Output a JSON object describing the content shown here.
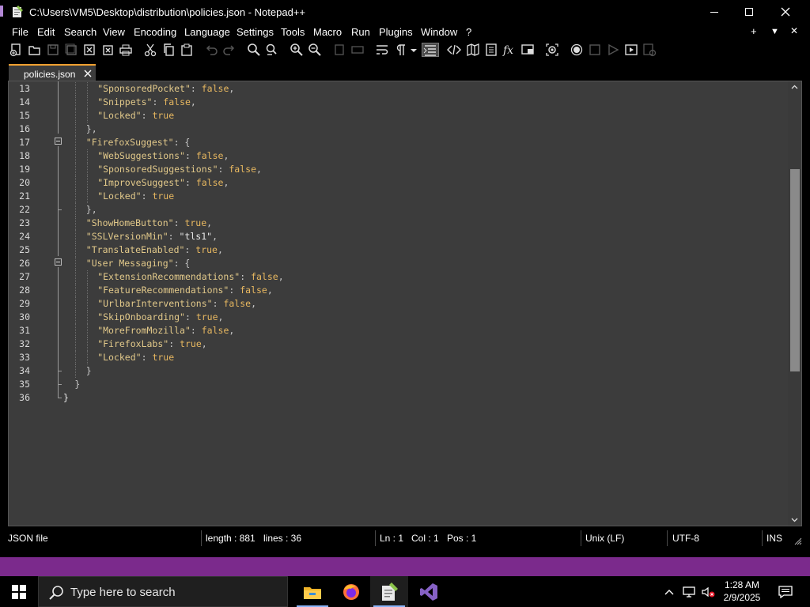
{
  "window": {
    "title": "C:\\Users\\VM5\\Desktop\\distribution\\policies.json - Notepad++"
  },
  "menu": {
    "items": [
      "File",
      "Edit",
      "Search",
      "View",
      "Encoding",
      "Language",
      "Settings",
      "Tools",
      "Macro",
      "Run",
      "Plugins",
      "Window",
      "?"
    ],
    "right": [
      "+",
      "▼",
      "✕"
    ]
  },
  "toolbar": {
    "icons": [
      "new-file-icon",
      "open-file-icon",
      "save-icon",
      "save-all-icon",
      "close-icon",
      "close-all-icon",
      "print-icon",
      "cut-icon",
      "copy-icon",
      "paste-icon",
      "undo-icon",
      "redo-icon",
      "find-icon",
      "replace-icon",
      "zoom-in-icon",
      "zoom-out-icon",
      "sync-vertical-icon",
      "sync-horizontal-icon",
      "word-wrap-icon",
      "show-all-characters-icon",
      "indent-guide-icon",
      "xml-tag-icon",
      "document-map-icon",
      "function-list-icon",
      "fx-icon",
      "folder-workspace-icon",
      "monitoring-icon",
      "record-macro-icon",
      "stop-record-icon",
      "play-macro-icon",
      "run-macro-multiple-icon",
      "save-macro-icon"
    ]
  },
  "tab": {
    "label": "policies.json"
  },
  "editor": {
    "lines": [
      {
        "n": "13",
        "indent": 3,
        "tokens": [
          [
            "s",
            "\"SponsoredPocket\""
          ],
          [
            "p",
            ": "
          ],
          [
            "b",
            "false"
          ],
          [
            "p",
            ","
          ]
        ]
      },
      {
        "n": "14",
        "indent": 3,
        "tokens": [
          [
            "s",
            "\"Snippets\""
          ],
          [
            "p",
            ": "
          ],
          [
            "b",
            "false"
          ],
          [
            "p",
            ","
          ]
        ]
      },
      {
        "n": "15",
        "indent": 3,
        "tokens": [
          [
            "s",
            "\"Locked\""
          ],
          [
            "p",
            ": "
          ],
          [
            "b",
            "true"
          ]
        ]
      },
      {
        "n": "16",
        "indent": 2,
        "tokens": [
          [
            "p",
            "},"
          ]
        ]
      },
      {
        "n": "17",
        "indent": 2,
        "tokens": [
          [
            "s",
            "\"FirefoxSuggest\""
          ],
          [
            "p",
            ": {"
          ]
        ]
      },
      {
        "n": "18",
        "indent": 3,
        "tokens": [
          [
            "s",
            "\"WebSuggestions\""
          ],
          [
            "p",
            ": "
          ],
          [
            "b",
            "false"
          ],
          [
            "p",
            ","
          ]
        ]
      },
      {
        "n": "19",
        "indent": 3,
        "tokens": [
          [
            "s",
            "\"SponsoredSuggestions\""
          ],
          [
            "p",
            ": "
          ],
          [
            "b",
            "false"
          ],
          [
            "p",
            ","
          ]
        ]
      },
      {
        "n": "20",
        "indent": 3,
        "tokens": [
          [
            "s",
            "\"ImproveSuggest\""
          ],
          [
            "p",
            ": "
          ],
          [
            "b",
            "false"
          ],
          [
            "p",
            ","
          ]
        ]
      },
      {
        "n": "21",
        "indent": 3,
        "tokens": [
          [
            "s",
            "\"Locked\""
          ],
          [
            "p",
            ": "
          ],
          [
            "b",
            "true"
          ]
        ]
      },
      {
        "n": "22",
        "indent": 2,
        "tokens": [
          [
            "p",
            "},"
          ]
        ]
      },
      {
        "n": "23",
        "indent": 2,
        "tokens": [
          [
            "s",
            "\"ShowHomeButton\""
          ],
          [
            "p",
            ": "
          ],
          [
            "b",
            "true"
          ],
          [
            "p",
            ","
          ]
        ]
      },
      {
        "n": "24",
        "indent": 2,
        "tokens": [
          [
            "s",
            "\"SSLVersionMin\""
          ],
          [
            "p",
            ": "
          ],
          [
            "k",
            "\"tls1\""
          ],
          [
            "p",
            ","
          ]
        ]
      },
      {
        "n": "25",
        "indent": 2,
        "tokens": [
          [
            "s",
            "\"TranslateEnabled\""
          ],
          [
            "p",
            ": "
          ],
          [
            "b",
            "true"
          ],
          [
            "p",
            ","
          ]
        ]
      },
      {
        "n": "26",
        "indent": 2,
        "tokens": [
          [
            "s",
            "\"User Messaging\""
          ],
          [
            "p",
            ": {"
          ]
        ]
      },
      {
        "n": "27",
        "indent": 3,
        "tokens": [
          [
            "s",
            "\"ExtensionRecommendations\""
          ],
          [
            "p",
            ": "
          ],
          [
            "b",
            "false"
          ],
          [
            "p",
            ","
          ]
        ]
      },
      {
        "n": "28",
        "indent": 3,
        "tokens": [
          [
            "s",
            "\"FeatureRecommendations\""
          ],
          [
            "p",
            ": "
          ],
          [
            "b",
            "false"
          ],
          [
            "p",
            ","
          ]
        ]
      },
      {
        "n": "29",
        "indent": 3,
        "tokens": [
          [
            "s",
            "\"UrlbarInterventions\""
          ],
          [
            "p",
            ": "
          ],
          [
            "b",
            "false"
          ],
          [
            "p",
            ","
          ]
        ]
      },
      {
        "n": "30",
        "indent": 3,
        "tokens": [
          [
            "s",
            "\"SkipOnboarding\""
          ],
          [
            "p",
            ": "
          ],
          [
            "b",
            "true"
          ],
          [
            "p",
            ","
          ]
        ]
      },
      {
        "n": "31",
        "indent": 3,
        "tokens": [
          [
            "s",
            "\"MoreFromMozilla\""
          ],
          [
            "p",
            ": "
          ],
          [
            "b",
            "false"
          ],
          [
            "p",
            ","
          ]
        ]
      },
      {
        "n": "32",
        "indent": 3,
        "tokens": [
          [
            "s",
            "\"FirefoxLabs\""
          ],
          [
            "p",
            ": "
          ],
          [
            "b",
            "true"
          ],
          [
            "p",
            ","
          ]
        ]
      },
      {
        "n": "33",
        "indent": 3,
        "tokens": [
          [
            "s",
            "\"Locked\""
          ],
          [
            "p",
            ": "
          ],
          [
            "b",
            "true"
          ]
        ]
      },
      {
        "n": "34",
        "indent": 2,
        "tokens": [
          [
            "p",
            "}"
          ]
        ]
      },
      {
        "n": "35",
        "indent": 1,
        "tokens": [
          [
            "p",
            "}"
          ]
        ]
      },
      {
        "n": "36",
        "indent": 0,
        "tokens": [
          [
            "k",
            "}"
          ]
        ]
      }
    ]
  },
  "status": {
    "type": "JSON file",
    "length": "length : 881",
    "lines": "lines : 36",
    "ln": "Ln : 1",
    "col": "Col : 1",
    "pos": "Pos : 1",
    "eol": "Unix (LF)",
    "encoding": "UTF-8",
    "mode": "INS"
  },
  "taskbar": {
    "search_placeholder": "Type here to search",
    "time": "1:28 AM",
    "date": "2/9/2025"
  },
  "colors": {
    "editor_bg": "#3c3c3c",
    "tab_accent": "#f0a030",
    "key": "#e2c98a",
    "boolean": "#e8b860",
    "desktop_strip": "#7b2a8c"
  }
}
